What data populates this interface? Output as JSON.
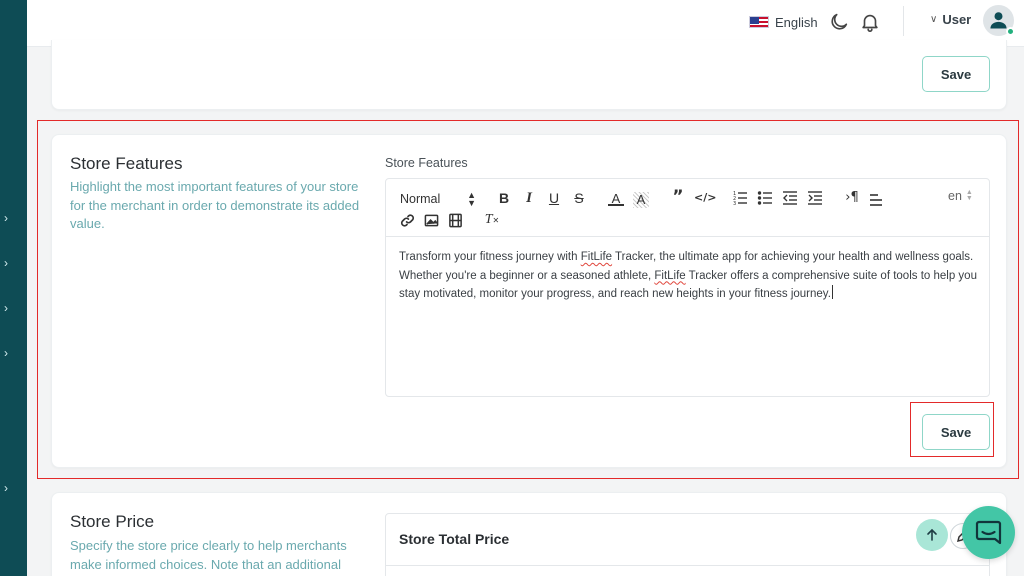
{
  "header": {
    "language_label": "English",
    "user_label": "User",
    "accent": "#0e4c55",
    "online_color": "#22b07d"
  },
  "sidebar": {
    "expand_icons": [
      "chevron-right-icon",
      "chevron-right-icon",
      "chevron-right-icon",
      "chevron-right-icon",
      "chevron-right-icon"
    ]
  },
  "top_card": {
    "save_label": "Save"
  },
  "store_features": {
    "title": "Store Features",
    "description": "Highlight the most important features of your store for the merchant in order to demonstrate its added value.",
    "field_label": "Store Features",
    "editor": {
      "format_value": "Normal",
      "language_value": "en",
      "content_parts": [
        "Transform your fitness journey with ",
        "FitLife",
        " Tracker, the ultimate app for achieving your health and wellness goals. Whether you're a beginner or a seasoned athlete, ",
        "FitLife",
        " Tracker offers a comprehensive suite of tools to help you stay motivated, monitor your progress, and reach new heights in your fitness journey."
      ]
    },
    "save_label": "Save"
  },
  "store_price": {
    "title": "Store Price",
    "description": "Specify the store price clearly to help merchants make informed choices. Note that an additional",
    "inner_title": "Store Total Price"
  },
  "colors": {
    "highlight": "#e32a2a",
    "save_border": "#8fd6c8",
    "chat_fab": "#43c6a6"
  }
}
